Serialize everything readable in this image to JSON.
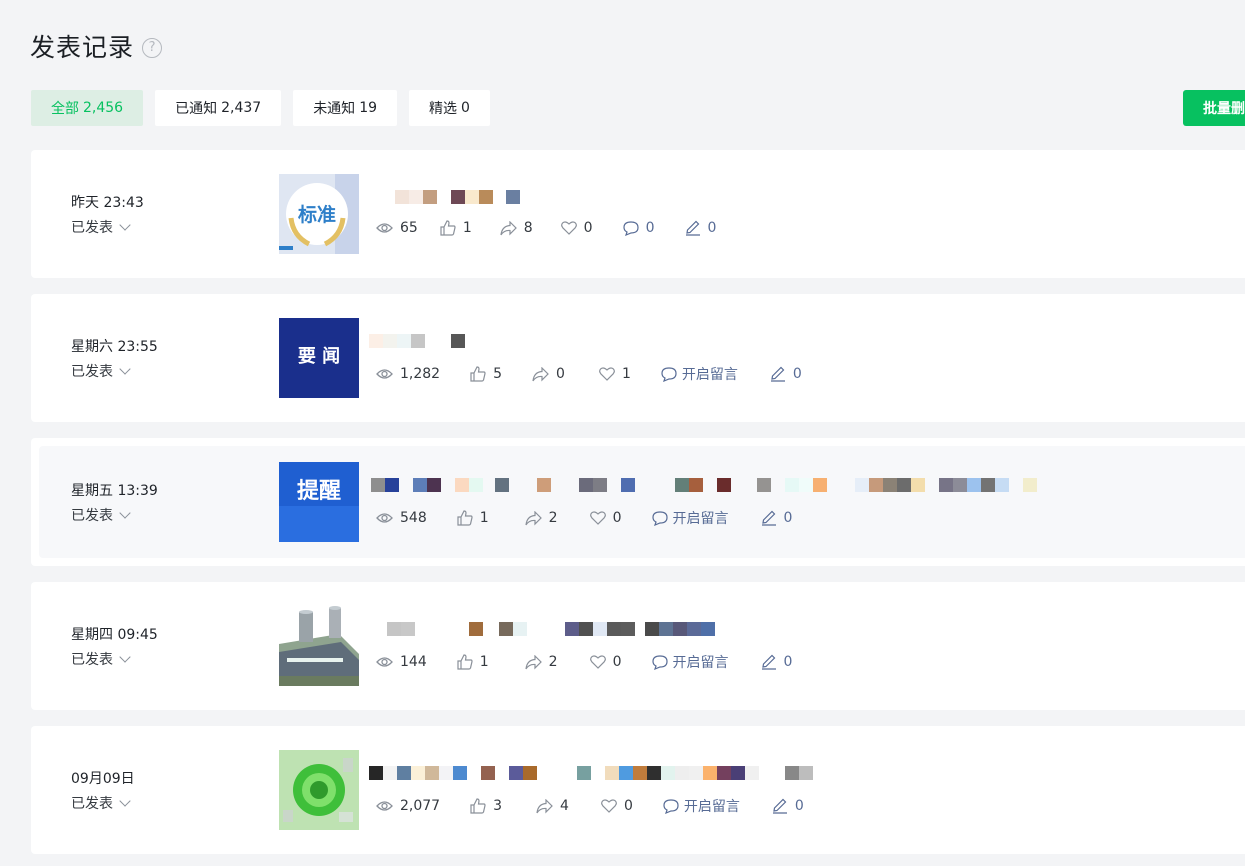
{
  "header": {
    "title": "发表记录",
    "help_glyph": "?"
  },
  "tabs": [
    {
      "label": "全部",
      "count": "2,456",
      "active": true
    },
    {
      "label": "已通知",
      "count": "2,437",
      "active": false
    },
    {
      "label": "未通知",
      "count": "19",
      "active": false
    },
    {
      "label": "精选",
      "count": "0",
      "active": false
    }
  ],
  "batch_button": {
    "label": "批量删除"
  },
  "records": [
    {
      "time": "昨天 23:43",
      "status": "已发表",
      "thumb_text": "标准",
      "views": "65",
      "likes": "1",
      "shares": "8",
      "favorites": "0",
      "comments": "0",
      "edits": "0"
    },
    {
      "time": "星期六 23:55",
      "status": "已发表",
      "thumb_text": "要 闻",
      "views": "1,282",
      "likes": "5",
      "shares": "0",
      "favorites": "1",
      "comments": "开启留言",
      "edits": "0"
    },
    {
      "time": "星期五 13:39",
      "status": "已发表",
      "thumb_text": "提醒",
      "views": "548",
      "likes": "1",
      "shares": "2",
      "favorites": "0",
      "comments": "开启留言",
      "edits": "0"
    },
    {
      "time": "星期四 09:45",
      "status": "已发表",
      "thumb_text": "",
      "views": "144",
      "likes": "1",
      "shares": "2",
      "favorites": "0",
      "comments": "开启留言",
      "edits": "0"
    },
    {
      "time": "09月09日",
      "status": "已发表",
      "thumb_text": "",
      "views": "2,077",
      "likes": "3",
      "shares": "4",
      "favorites": "0",
      "comments": "开启留言",
      "edits": "0"
    }
  ],
  "colors": {
    "accent": "#07c160",
    "link": "#576b95",
    "tab_active_bg": "#ddeee4"
  },
  "icons": [
    "help-icon",
    "eye-icon",
    "thumbs-up-icon",
    "share-icon",
    "heart-icon",
    "comment-icon",
    "pen-icon",
    "chevron-down-icon"
  ]
}
